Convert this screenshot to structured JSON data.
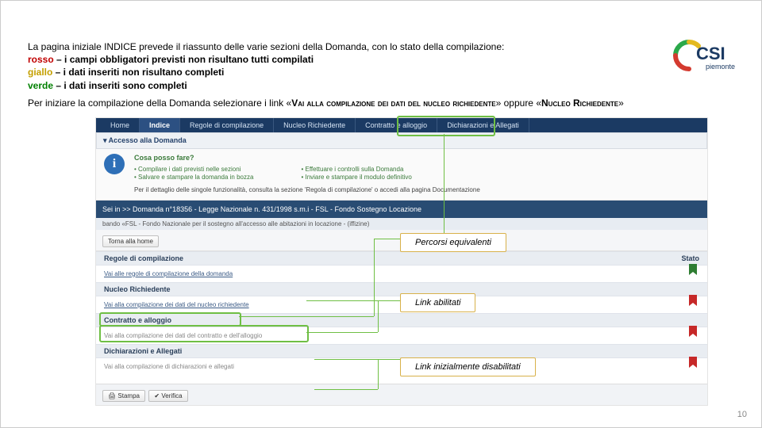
{
  "instr": {
    "line1": "La pagina iniziale INDICE prevede il riassunto delle varie sezioni della Domanda, con lo stato della compilazione:",
    "rosso": "rosso",
    "rosso_t": " – i campi obbligatori previsti non risultano tutti compilati",
    "giallo": "giallo",
    "giallo_t": " – i dati inseriti non risultano completi",
    "verde": "verde",
    "verde_t": " – i dati inseriti sono completi",
    "line5a": "Per iniziare la compilazione della Domanda selezionare i link «",
    "link1": "Vai alla compilazione dei dati del nucleo richiedente",
    "line5b": "» oppure «",
    "link2": "Nucleo Richiedente",
    "line5c": "»"
  },
  "logo": {
    "big": "CSI",
    "small": "piemonte"
  },
  "nav": {
    "items": [
      "Home",
      "Indice",
      "Regole di compilazione",
      "Nucleo Richiedente",
      "Contratto e alloggio",
      "Dichiarazioni e Allegati"
    ]
  },
  "access": {
    "title": "▾ Accesso alla Domanda"
  },
  "info": {
    "q": "Cosa posso fare?",
    "colA": [
      "• Compilare i dati previsti nelle sezioni",
      "• Salvare e stampare la domanda in bozza"
    ],
    "colB": [
      "• Effettuare i controlli sulla Domanda",
      "• Inviare e stampare il modulo definitivo"
    ],
    "det": "Per il dettaglio delle singole funzionalità, consulta la sezione 'Regola di compilazione' o accedi alla pagina Documentazione"
  },
  "context": {
    "main": "Sei in >> Domanda n°18356 - Legge Nazionale n. 431/1998 s.m.i - FSL - Fondo Sostegno Locazione",
    "sub": "bando «FSL - Fondo Nazionale per il sostegno all'accesso alle abitazioni in locazione - (iffizine)"
  },
  "btn": {
    "home": "Torna alla home"
  },
  "stato_label": "Stato",
  "groups": {
    "regole": {
      "title": "Regole di compilazione",
      "item": "Vai alle regole di compilazione della domanda"
    },
    "nucleo": {
      "title": "Nucleo Richiedente",
      "item": "Vai alla compilazione dei dati del nucleo richiedente"
    },
    "contratto": {
      "title": "Contratto e alloggio",
      "item": "Vai alla compilazione dei dati del contratto e dell'alloggio"
    },
    "dich": {
      "title": "Dichiarazioni e Allegati",
      "item": "Vai alla compilazione di dichiarazioni e allegati"
    }
  },
  "foot": {
    "stampa": "Stampa",
    "verifica": "Verifica"
  },
  "callouts": {
    "c1": "Percorsi equivalenti",
    "c2": "Link abilitati",
    "c3": "Link inizialmente disabilitati"
  },
  "pagenum": "10",
  "bookmark_colors": {
    "ok": "#2e7d32",
    "bad": "#c62828"
  }
}
